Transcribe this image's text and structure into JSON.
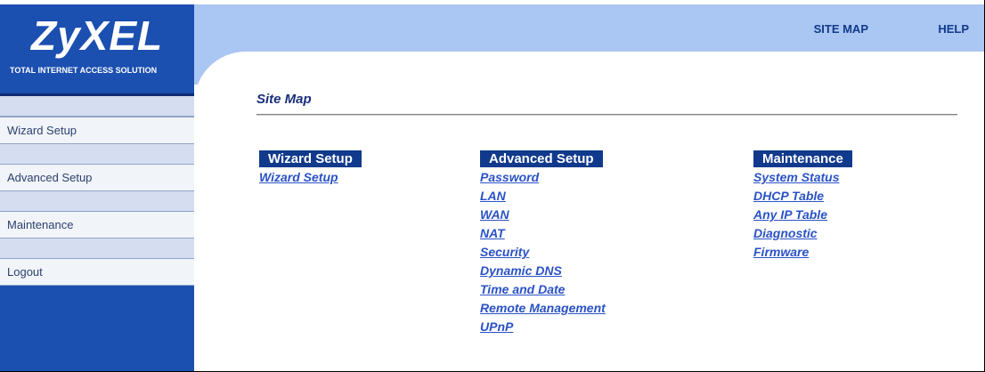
{
  "header": {
    "logo_text": "ZyXEL",
    "logo_tagline": "TOTAL INTERNET ACCESS SOLUTION",
    "links": [
      {
        "label": "SITE MAP"
      },
      {
        "label": "HELP"
      }
    ]
  },
  "sidebar": {
    "items": [
      {
        "label": "Wizard Setup"
      },
      {
        "label": "Advanced Setup"
      },
      {
        "label": "Maintenance"
      },
      {
        "label": "Logout"
      }
    ]
  },
  "main": {
    "title": "Site Map",
    "columns": [
      {
        "header": "Wizard Setup",
        "links": [
          "Wizard Setup"
        ]
      },
      {
        "header": "Advanced Setup",
        "links": [
          "Password",
          "LAN",
          "WAN",
          "NAT",
          "Security",
          "Dynamic DNS",
          "Time and Date",
          "Remote Management",
          "UPnP"
        ]
      },
      {
        "header": "Maintenance",
        "links": [
          "System Status",
          "DHCP Table",
          "Any IP Table",
          "Diagnostic",
          "Firmware"
        ]
      }
    ]
  },
  "colors": {
    "brand_blue": "#1b4fb0",
    "header_band": "#aac6f2",
    "link_blue": "#2a52c6",
    "column_header_bg": "#113a8c"
  }
}
